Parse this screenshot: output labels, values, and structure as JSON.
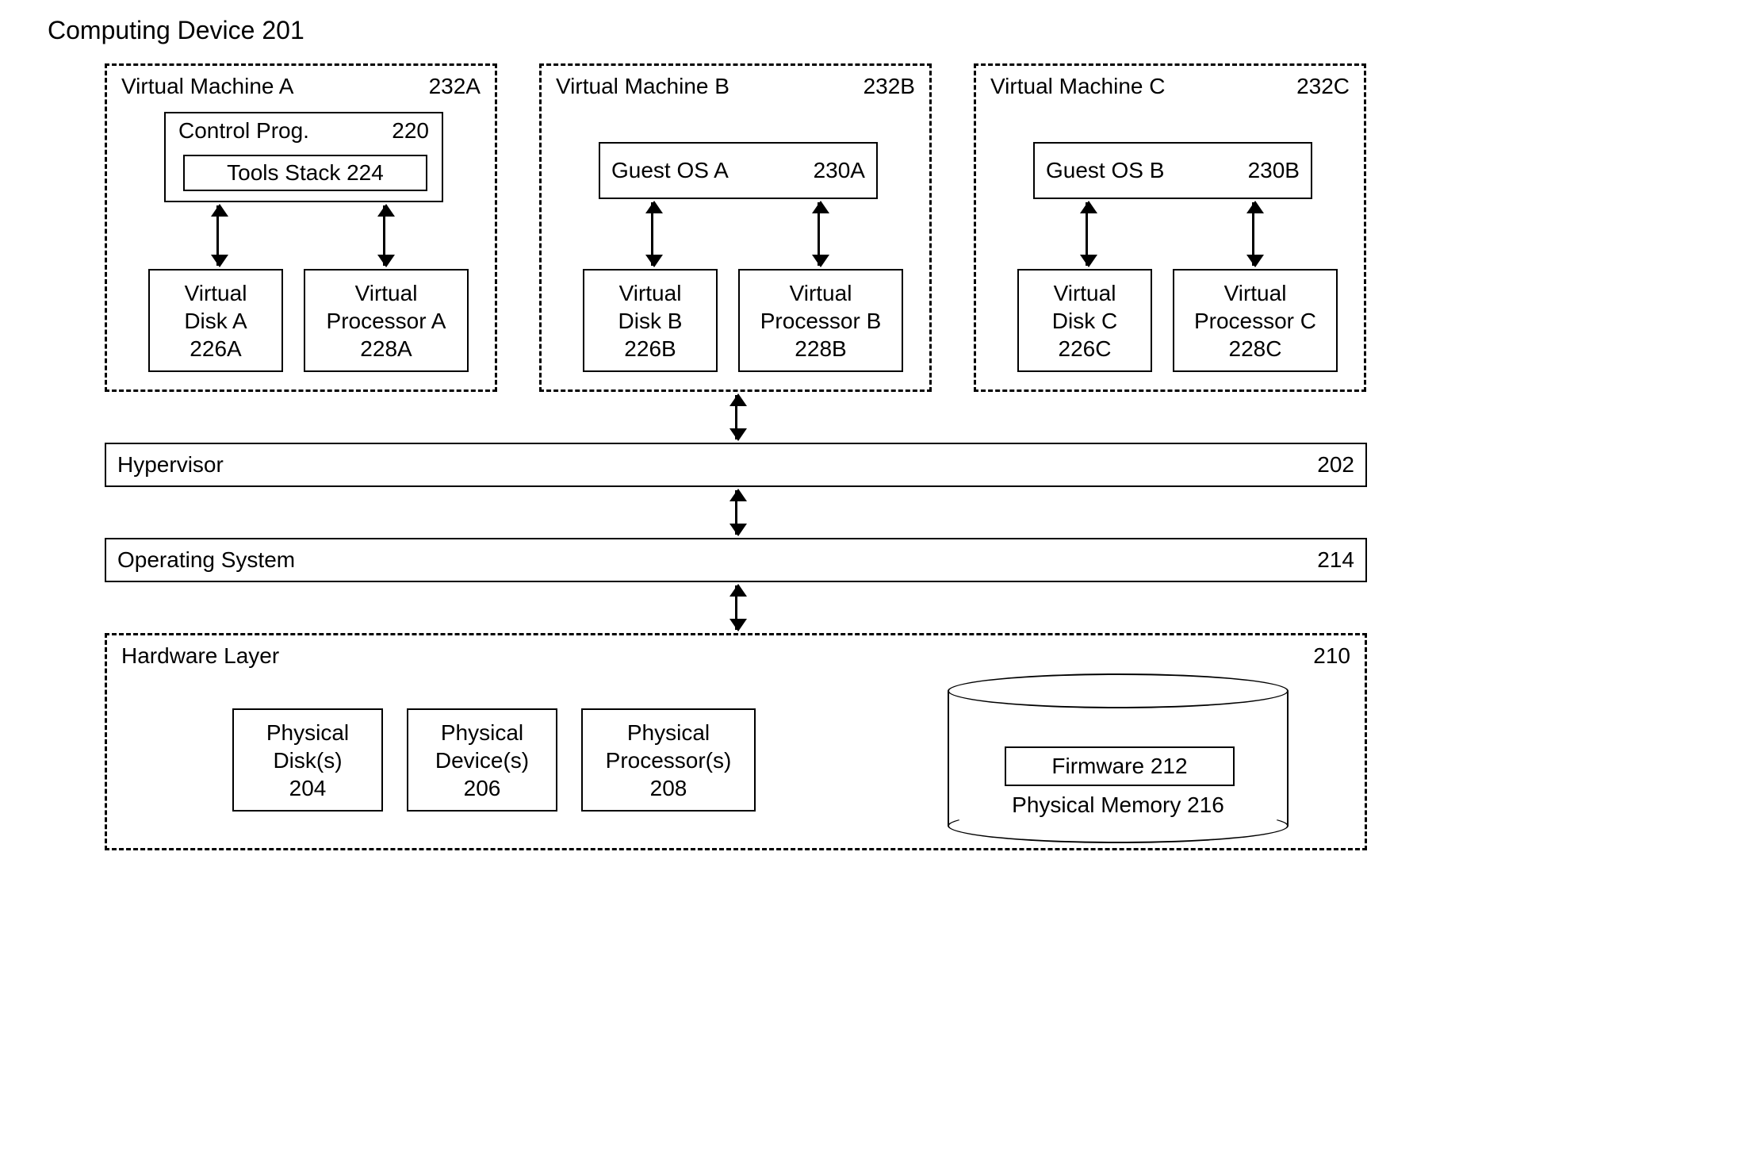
{
  "title": "Computing Device 201",
  "vms": {
    "a": {
      "header_label": "Virtual Machine A",
      "header_ref": "232A",
      "control": {
        "label": "Control Prog.",
        "ref": "220"
      },
      "tools": "Tools Stack 224",
      "disk": {
        "l1": "Virtual",
        "l2": "Disk A",
        "l3": "226A"
      },
      "proc": {
        "l1": "Virtual",
        "l2": "Processor A",
        "l3": "228A"
      }
    },
    "b": {
      "header_label": "Virtual Machine B",
      "header_ref": "232B",
      "guest": {
        "label": "Guest OS A",
        "ref": "230A"
      },
      "disk": {
        "l1": "Virtual",
        "l2": "Disk B",
        "l3": "226B"
      },
      "proc": {
        "l1": "Virtual",
        "l2": "Processor B",
        "l3": "228B"
      }
    },
    "c": {
      "header_label": "Virtual Machine C",
      "header_ref": "232C",
      "guest": {
        "label": "Guest OS B",
        "ref": "230B"
      },
      "disk": {
        "l1": "Virtual",
        "l2": "Disk C",
        "l3": "226C"
      },
      "proc": {
        "l1": "Virtual",
        "l2": "Processor C",
        "l3": "228C"
      }
    }
  },
  "hypervisor": {
    "label": "Hypervisor",
    "ref": "202"
  },
  "os": {
    "label": "Operating System",
    "ref": "214"
  },
  "hardware": {
    "header_label": "Hardware Layer",
    "header_ref": "210",
    "disk": {
      "l1": "Physical",
      "l2": "Disk(s)",
      "l3": "204"
    },
    "device": {
      "l1": "Physical",
      "l2": "Device(s)",
      "l3": "206"
    },
    "proc": {
      "l1": "Physical",
      "l2": "Processor(s)",
      "l3": "208"
    },
    "firmware": "Firmware 212",
    "memory": "Physical Memory 216"
  }
}
